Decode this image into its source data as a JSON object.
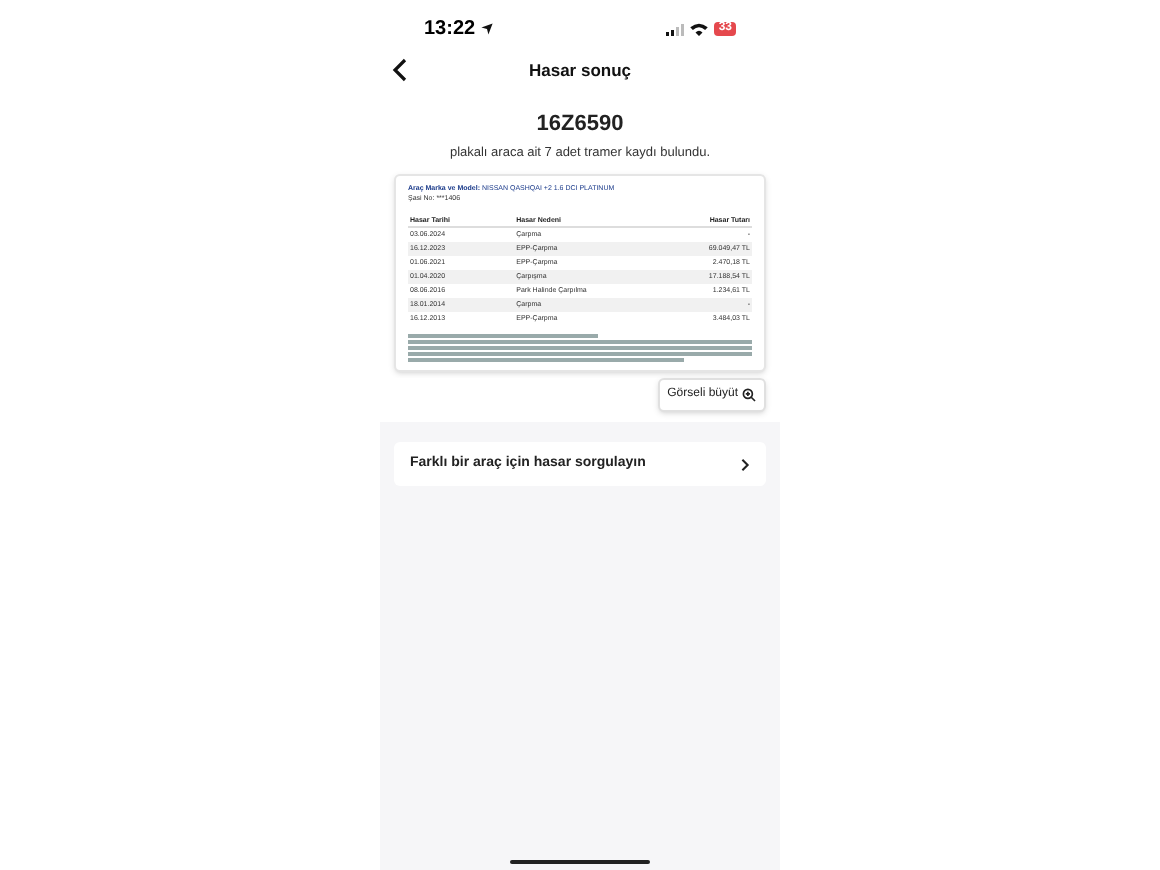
{
  "status_bar": {
    "time": "13:22",
    "battery": "33"
  },
  "nav": {
    "title": "Hasar sonuç"
  },
  "result": {
    "plate": "16Z6590",
    "summary": "plakalı araca ait 7 adet tramer kaydı bulundu."
  },
  "report": {
    "model_label": "Araç Marka ve Model:",
    "model": "NISSAN QASHQAI +2 1.6 DCI PLATINUM",
    "chassis": "Şasi No: ***1406",
    "columns": [
      "Hasar Tarihi",
      "Hasar Nedeni",
      "Hasar Tutarı"
    ],
    "rows": [
      {
        "date": "03.06.2024",
        "reason": "Çarpma",
        "amount": "-"
      },
      {
        "date": "16.12.2023",
        "reason": "EPP-Çarpma",
        "amount": "69.049,47 TL"
      },
      {
        "date": "01.06.2021",
        "reason": "EPP-Çarpma",
        "amount": "2.470,18 TL"
      },
      {
        "date": "01.04.2020",
        "reason": "Çarpışma",
        "amount": "17.188,54 TL"
      },
      {
        "date": "08.06.2016",
        "reason": "Park Halinde Çarpılma",
        "amount": "1.234,61 TL"
      },
      {
        "date": "18.01.2014",
        "reason": "Çarpma",
        "amount": "-"
      },
      {
        "date": "16.12.2013",
        "reason": "EPP-Çarpma",
        "amount": "3.484,03 TL"
      }
    ]
  },
  "enlarge_button": {
    "label": "Görseli büyüt"
  },
  "other_query": {
    "label": "Farklı bir araç için hasar sorgulayın"
  }
}
